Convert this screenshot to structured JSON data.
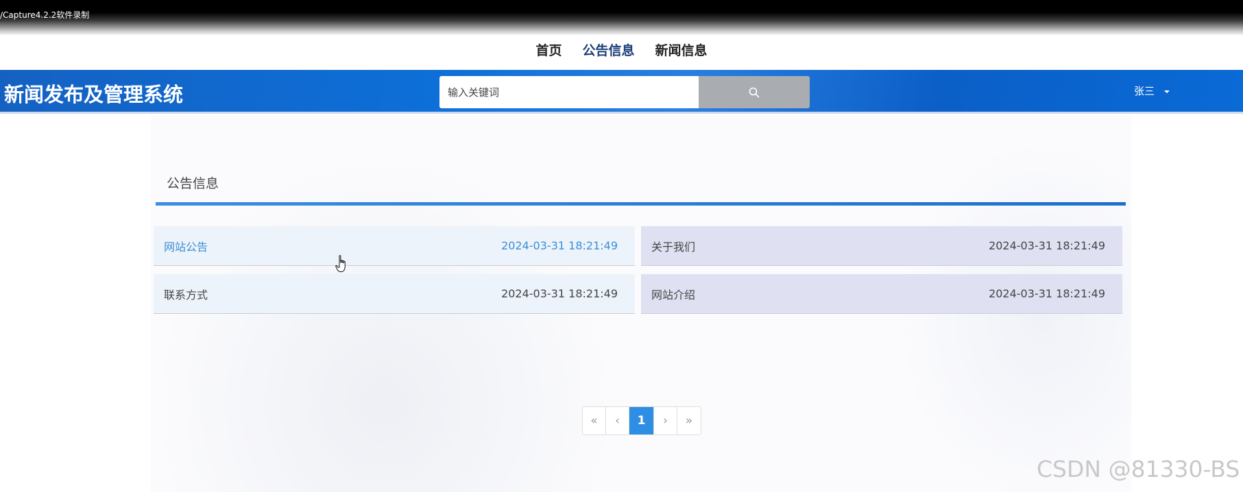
{
  "recording_label": "/Capture4.2.2软件录制",
  "nav": {
    "items": [
      {
        "label": "首页"
      },
      {
        "label": "公告信息",
        "active": true
      },
      {
        "label": "新闻信息"
      }
    ]
  },
  "header": {
    "brand": "新闻发布及管理系统",
    "search_placeholder": "输入关键词",
    "user_name": "张三",
    "accent_color": "#0d6fd8"
  },
  "section": {
    "title": "公告信息"
  },
  "notices": [
    {
      "title": "网站公告",
      "time": "2024-03-31 18:21:49"
    },
    {
      "title": "关于我们",
      "time": "2024-03-31 18:21:49"
    },
    {
      "title": "联系方式",
      "time": "2024-03-31 18:21:49"
    },
    {
      "title": "网站介绍",
      "time": "2024-03-31 18:21:49"
    }
  ],
  "pagination": {
    "first": "«",
    "prev": "‹",
    "current": "1",
    "next": "›",
    "last": "»"
  },
  "watermark": "CSDN @81330-BS"
}
